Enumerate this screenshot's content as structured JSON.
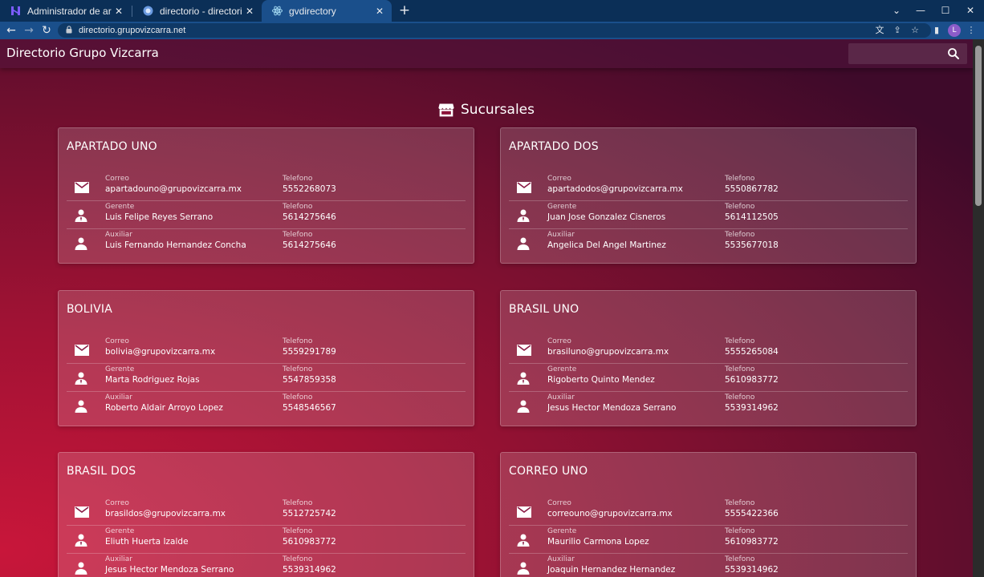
{
  "browser": {
    "tabs": [
      {
        "title": "Administrador de archivos | hPan",
        "favicon": "hpanel-icon"
      },
      {
        "title": "directorio - directorio - directorio",
        "favicon": "database-icon"
      },
      {
        "title": "gvdirectory",
        "favicon": "react-icon"
      }
    ],
    "url": "directorio.grupovizcarra.net",
    "profile_initial": "L"
  },
  "app": {
    "title": "Directorio Grupo Vizcarra",
    "search_placeholder": ""
  },
  "section": {
    "title": "Sucursales",
    "icon": "store-icon"
  },
  "branches": [
    {
      "name": "APARTADO UNO",
      "rows": [
        {
          "label": "Correo",
          "value": "apartadouno@grupovizcarra.mx",
          "phone_label": "Telefono",
          "phone": "5552268073",
          "icon": "mail-icon"
        },
        {
          "label": "Gerente",
          "value": "Luis Felipe Reyes Serrano",
          "phone_label": "Telefono",
          "phone": "5614275646",
          "icon": "manager-icon"
        },
        {
          "label": "Auxiliar",
          "value": "Luis Fernando Hernandez Concha",
          "phone_label": "Telefono",
          "phone": "5614275646",
          "icon": "person-icon"
        }
      ]
    },
    {
      "name": "APARTADO DOS",
      "rows": [
        {
          "label": "Correo",
          "value": "apartadodos@grupovizcarra.mx",
          "phone_label": "Telefono",
          "phone": "5550867782",
          "icon": "mail-icon"
        },
        {
          "label": "Gerente",
          "value": "Juan Jose Gonzalez Cisneros",
          "phone_label": "Telefono",
          "phone": "5614112505",
          "icon": "manager-icon"
        },
        {
          "label": "Auxiliar",
          "value": "Angelica Del Angel Martinez",
          "phone_label": "Telefono",
          "phone": "5535677018",
          "icon": "person-icon"
        }
      ]
    },
    {
      "name": "BOLIVIA",
      "rows": [
        {
          "label": "Correo",
          "value": "bolivia@grupovizcarra.mx",
          "phone_label": "Telefono",
          "phone": "5559291789",
          "icon": "mail-icon"
        },
        {
          "label": "Gerente",
          "value": "Marta Rodriguez Rojas",
          "phone_label": "Telefono",
          "phone": "5547859358",
          "icon": "manager-icon"
        },
        {
          "label": "Auxiliar",
          "value": "Roberto Aldair Arroyo Lopez",
          "phone_label": "Telefono",
          "phone": "5548546567",
          "icon": "person-icon"
        }
      ]
    },
    {
      "name": "BRASIL UNO",
      "rows": [
        {
          "label": "Correo",
          "value": "brasiluno@grupovizcarra.mx",
          "phone_label": "Telefono",
          "phone": "5555265084",
          "icon": "mail-icon"
        },
        {
          "label": "Gerente",
          "value": "Rigoberto Quinto Mendez",
          "phone_label": "Telefono",
          "phone": "5610983772",
          "icon": "manager-icon"
        },
        {
          "label": "Auxiliar",
          "value": "Jesus Hector Mendoza Serrano",
          "phone_label": "Telefono",
          "phone": "5539314962",
          "icon": "person-icon"
        }
      ]
    },
    {
      "name": "BRASIL DOS",
      "rows": [
        {
          "label": "Correo",
          "value": "brasildos@grupovizcarra.mx",
          "phone_label": "Telefono",
          "phone": "5512725742",
          "icon": "mail-icon"
        },
        {
          "label": "Gerente",
          "value": "Eliuth Huerta Izalde",
          "phone_label": "Telefono",
          "phone": "5610983772",
          "icon": "manager-icon"
        },
        {
          "label": "Auxiliar",
          "value": "Jesus Hector Mendoza Serrano",
          "phone_label": "Telefono",
          "phone": "5539314962",
          "icon": "person-icon"
        }
      ]
    },
    {
      "name": "CORREO UNO",
      "rows": [
        {
          "label": "Correo",
          "value": "correouno@grupovizcarra.mx",
          "phone_label": "Telefono",
          "phone": "5555422366",
          "icon": "mail-icon"
        },
        {
          "label": "Gerente",
          "value": "Maurilio Carmona Lopez",
          "phone_label": "Telefono",
          "phone": "5610983772",
          "icon": "manager-icon"
        },
        {
          "label": "Auxiliar",
          "value": "Joaquin Hernandez Hernandez",
          "phone_label": "Telefono",
          "phone": "5539314962",
          "icon": "person-icon"
        }
      ]
    }
  ]
}
